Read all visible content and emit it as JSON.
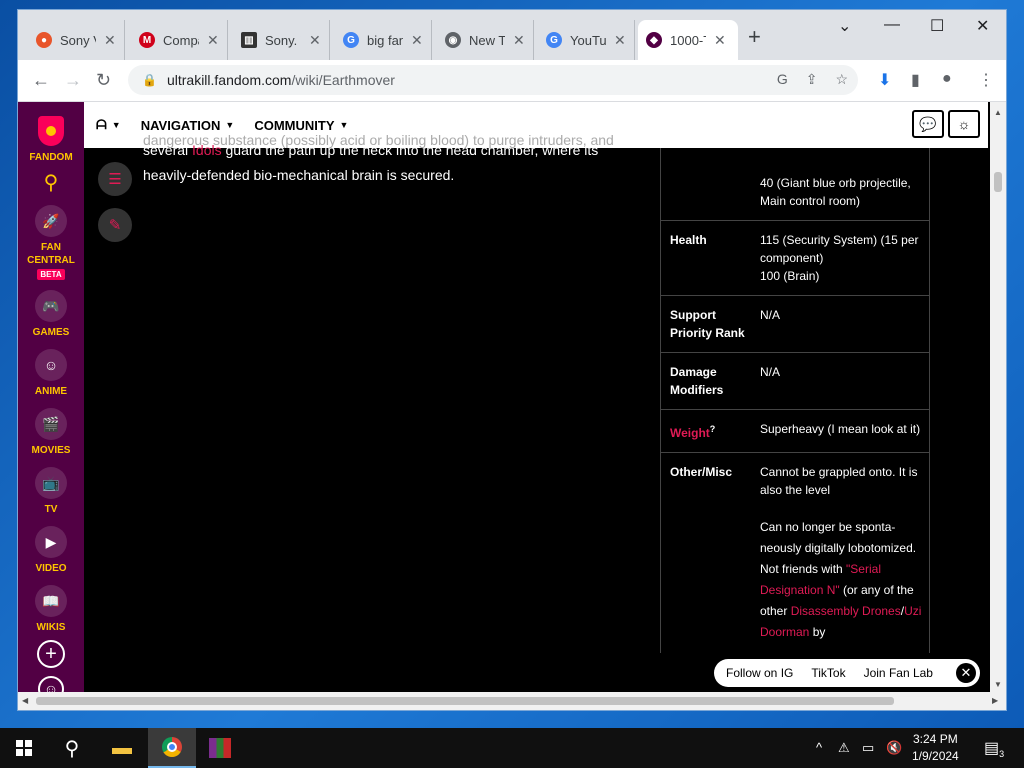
{
  "browser": {
    "tabs": [
      {
        "title": "Sony V",
        "fav_color": "#e8552b",
        "fav_glyph": "●"
      },
      {
        "title": "Compa",
        "fav_color": "#d0021b",
        "fav_glyph": "M"
      },
      {
        "title": "Sony. V",
        "fav_color": "#333333",
        "fav_glyph": "▥"
      },
      {
        "title": "big fan",
        "fav_color": "#4285f4",
        "fav_glyph": "G"
      },
      {
        "title": "New Ta",
        "fav_color": "#5f6368",
        "fav_glyph": "◉"
      },
      {
        "title": "YouTub",
        "fav_color": "#4285f4",
        "fav_glyph": "G"
      },
      {
        "title": "1000-T",
        "fav_color": "#520044",
        "fav_glyph": "◆"
      }
    ],
    "url_host": "ultrakill.fandom.com",
    "url_path": "/wiki/Earthmover"
  },
  "fandom_rail": {
    "logo_label": "FANDOM",
    "items": [
      {
        "label": "FAN CENTRAL",
        "glyph": "🚀",
        "beta": "BETA"
      },
      {
        "label": "GAMES",
        "glyph": "🎮"
      },
      {
        "label": "ANIME",
        "glyph": "☺"
      },
      {
        "label": "MOVIES",
        "glyph": "🎬"
      },
      {
        "label": "TV",
        "glyph": "📺"
      },
      {
        "label": "VIDEO",
        "glyph": "▶"
      },
      {
        "label": "WIKIS",
        "glyph": "📖"
      }
    ]
  },
  "topbar": {
    "navigation": "NAVIGATION",
    "community": "COMMUNITY"
  },
  "article": {
    "cut_line": "dangerous substance (possibly acid or boiling blood) to purge intruders, and",
    "line2_pre": "several ",
    "line2_link": "Idols",
    "line2_post": " guard the path up the neck into the head chamber, where its",
    "line3": "heavily-defended bio-mechanical brain is secured."
  },
  "infobox": {
    "top_val": "40 (Giant blue orb projectile, Main control room)",
    "health_label": "Health",
    "health_val1": "115 (Security System) (15 per component)",
    "health_val2": "100 (Brain)",
    "support_label": "Support Priority Rank",
    "support_val": "N/A",
    "damage_label": "Damage Modifiers",
    "damage_val": "N/A",
    "weight_label": "Weight",
    "weight_sup": "?",
    "weight_val": "Superheavy (I mean look at it)",
    "misc_label": "Other/Misc",
    "misc_val1": "Cannot be grappled onto. It is also the level",
    "misc_val2": "Can no longer be sponta-neously digitally lobotomized.",
    "misc_val3_pre": "Not friends with ",
    "misc_val3_link": "\"Serial Designation N\"",
    "misc_val3_post": " (or any of the other ",
    "misc_val3_link2": "Disassembly Drones",
    "misc_val3_sep": "/",
    "misc_val3_link3": "Uzi Doorman",
    "misc_val3_end": " by"
  },
  "follow_bar": {
    "ig": "Follow on IG",
    "tiktok": "TikTok",
    "fanlab": "Join Fan Lab"
  },
  "taskbar": {
    "time": "3:24 PM",
    "date": "1/9/2024",
    "notif_count": "3"
  }
}
